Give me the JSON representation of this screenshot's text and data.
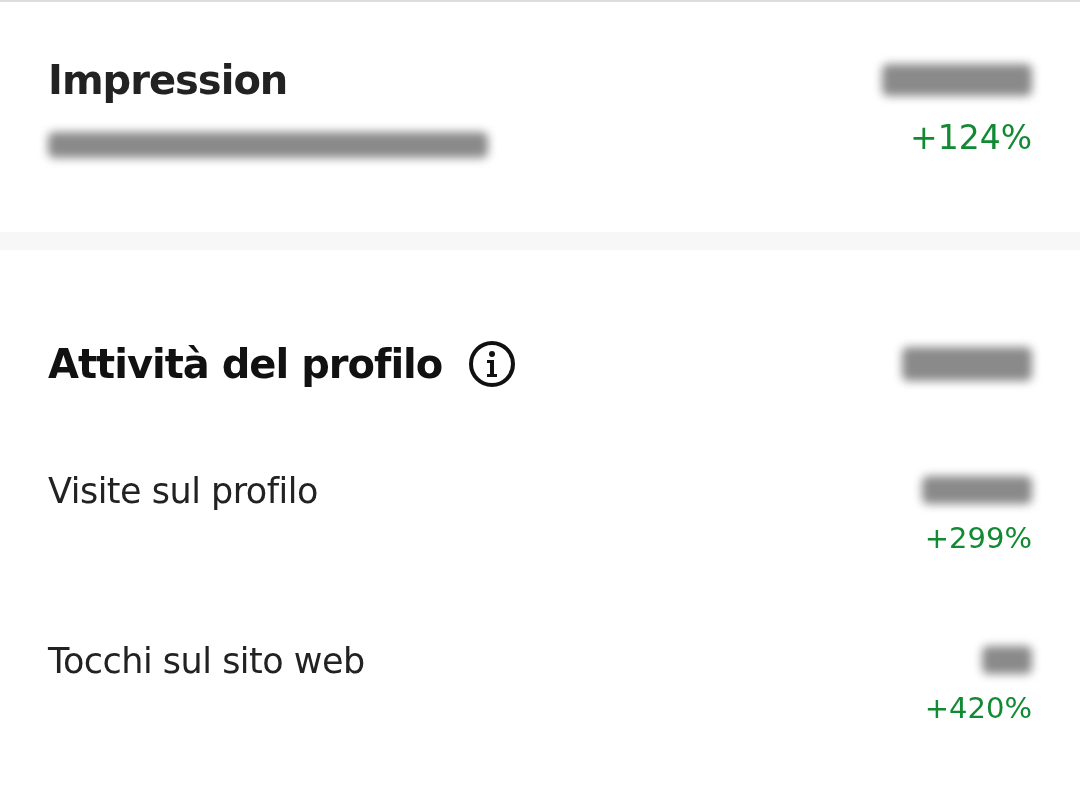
{
  "impression": {
    "title": "Impression",
    "change": "+124%"
  },
  "profile_activity": {
    "title": "Attività del profilo",
    "rows": [
      {
        "label": "Visite sul profilo",
        "change": "+299%"
      },
      {
        "label": "Tocchi sul sito web",
        "change": "+420%"
      }
    ]
  }
}
